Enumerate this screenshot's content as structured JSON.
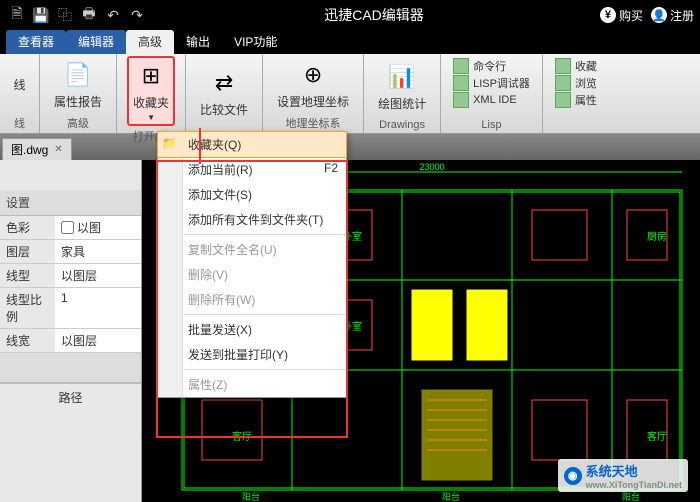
{
  "titlebar": {
    "title": "迅捷CAD编辑器",
    "buy": "购买",
    "register": "注册"
  },
  "tabs": {
    "viewer": "查看器",
    "editor": "编辑器",
    "advanced": "高级",
    "output": "输出",
    "vip": "VIP功能"
  },
  "ribbon": {
    "line_label": "线",
    "attrreport": "属性报告",
    "advanced": "高级",
    "favorites": "收藏夹",
    "open_label": "打开(P)",
    "compare": "比较文件",
    "settings_label": "设置地理坐标",
    "geo_label": "地理坐标系",
    "drawstats": "绘图统计",
    "drawings": "Drawings",
    "cmdline": "命令行",
    "lispdbg": "LISP调试器",
    "xmlide": "XML IDE",
    "lisp": "Lisp",
    "collect": "收藏",
    "browse": "浏览",
    "attr": "属性"
  },
  "doc": {
    "tab": "图.dwg"
  },
  "props": {
    "header": "设置",
    "color": "色彩",
    "color_val": "以图",
    "layer": "图层",
    "layer_val": "家具",
    "linetype": "线型",
    "linetype_val": "以图层",
    "linescale": "线型比例",
    "linescale_val": "1",
    "lineweight": "线宽",
    "lineweight_val": "以图层",
    "path": "路径"
  },
  "menu": {
    "favorites": "收藏夹(Q)",
    "addcurrent": "添加当前(R)",
    "addcurrent_sc": "F2",
    "addfile": "添加文件(S)",
    "addall": "添加所有文件到文件夹(T)",
    "copyfull": "复制文件全名(U)",
    "delete": "删除(V)",
    "deleteall": "删除所有(W)",
    "batchsend": "批量发送(X)",
    "sendbatchprint": "发送到批量打印(Y)",
    "props": "属性(Z)"
  },
  "watermark": {
    "name": "系统天地",
    "url": "www.XiTongTianDi.net"
  }
}
